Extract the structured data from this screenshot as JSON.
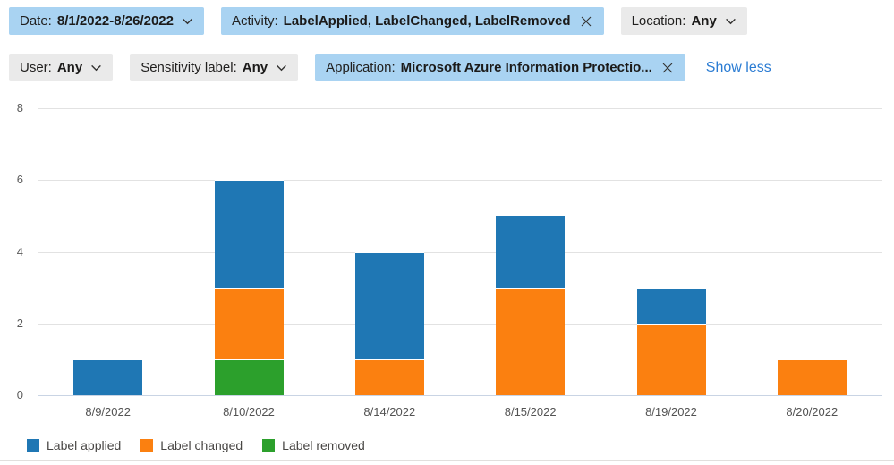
{
  "filters": {
    "row1": [
      {
        "label": "Date:",
        "value": "8/1/2022-8/26/2022",
        "control": "dropdown",
        "selected": true
      },
      {
        "label": "Activity:",
        "value": "LabelApplied, LabelChanged, LabelRemoved",
        "control": "clear",
        "selected": true
      },
      {
        "label": "Location:",
        "value": "Any",
        "control": "dropdown",
        "selected": false
      }
    ],
    "row2": [
      {
        "label": "User:",
        "value": "Any",
        "control": "dropdown",
        "selected": false
      },
      {
        "label": "Sensitivity label:",
        "value": "Any",
        "control": "dropdown",
        "selected": false
      },
      {
        "label": "Application:",
        "value": "Microsoft Azure Information Protectio...",
        "control": "clear",
        "selected": true
      }
    ],
    "show_less_label": "Show less"
  },
  "chart_data": {
    "type": "bar",
    "stacked": true,
    "title": "",
    "xlabel": "",
    "ylabel": "",
    "categories": [
      "8/9/2022",
      "8/10/2022",
      "8/14/2022",
      "8/15/2022",
      "8/19/2022",
      "8/20/2022"
    ],
    "series": [
      {
        "name": "Label applied",
        "color": "#1f77b4",
        "values": [
          1,
          3,
          3,
          2,
          1,
          0
        ]
      },
      {
        "name": "Label changed",
        "color": "#fb8010",
        "values": [
          0,
          2,
          1,
          3,
          2,
          1
        ]
      },
      {
        "name": "Label removed",
        "color": "#2ca02c",
        "values": [
          0,
          1,
          0,
          0,
          0,
          0
        ]
      }
    ],
    "stack_order_bottom_to_top": [
      "Label removed",
      "Label changed",
      "Label applied"
    ],
    "totals_per_category": [
      1,
      6,
      4,
      5,
      3,
      1
    ],
    "ylim": [
      0,
      8
    ],
    "yticks": [
      0,
      2,
      4,
      6,
      8
    ],
    "grid": true,
    "legend_position": "bottom"
  },
  "colors": {
    "pill_selected_bg": "#a9d3f2",
    "pill_default_bg": "#eaeaea",
    "link": "#2b7cd3",
    "bar_blue": "#1f77b4",
    "bar_orange": "#fb8010",
    "bar_green": "#2ca02c"
  }
}
